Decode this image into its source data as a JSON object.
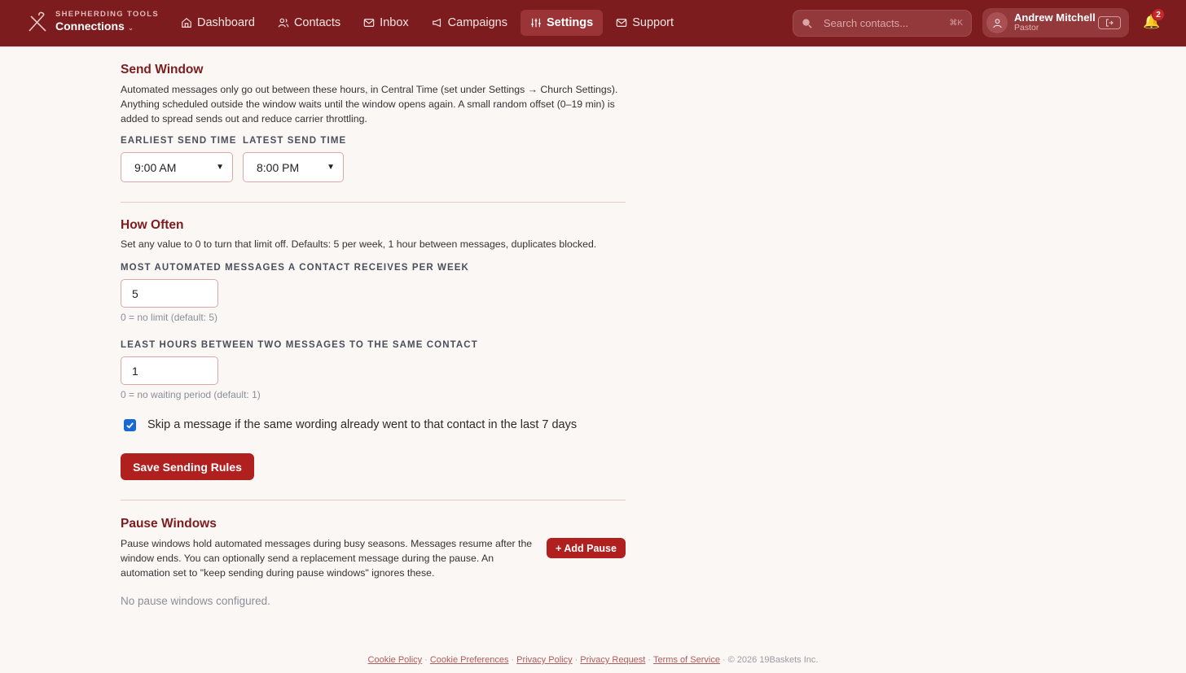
{
  "brand": {
    "small": "SHEPHERDING TOOLS",
    "main": "Connections",
    "caret": "⌄"
  },
  "nav": {
    "items": [
      {
        "label": "Dashboard",
        "icon": "home-icon"
      },
      {
        "label": "Contacts",
        "icon": "contacts-icon"
      },
      {
        "label": "Inbox",
        "icon": "mail-icon"
      },
      {
        "label": "Campaigns",
        "icon": "megaphone-icon"
      },
      {
        "label": "Settings",
        "icon": "sliders-icon",
        "active": true
      },
      {
        "label": "Support",
        "icon": "mail-icon"
      }
    ]
  },
  "search": {
    "placeholder": "Search contacts...",
    "shortcut": "⌘K"
  },
  "user": {
    "name": "Andrew Mitchell",
    "role": "Pastor"
  },
  "notifications": {
    "count": "2"
  },
  "send_window": {
    "title": "Send Window",
    "description": "Automated messages only go out between these hours, in Central Time (set under Settings → Church Settings). Anything scheduled outside the window waits until the window opens again. A small random offset (0–19 min) is added to spread sends out and reduce carrier throttling.",
    "earliest_label": "EARLIEST SEND TIME",
    "earliest_value": "9:00 AM",
    "latest_label": "LATEST SEND TIME",
    "latest_value": "8:00 PM"
  },
  "how_often": {
    "title": "How Often",
    "description": "Set any value to 0 to turn that limit off. Defaults: 5 per week, 1 hour between messages, duplicates blocked.",
    "per_week_label": "MOST AUTOMATED MESSAGES A CONTACT RECEIVES PER WEEK",
    "per_week_value": "5",
    "per_week_hint": "0 = no limit (default: 5)",
    "hours_label": "LEAST HOURS BETWEEN TWO MESSAGES TO THE SAME CONTACT",
    "hours_value": "1",
    "hours_hint": "0 = no waiting period (default: 1)",
    "skip_duplicate_label": "Skip a message if the same wording already went to that contact in the last 7 days",
    "skip_duplicate_checked": true,
    "save_label": "Save Sending Rules"
  },
  "pause_windows": {
    "title": "Pause Windows",
    "description": "Pause windows hold automated messages during busy seasons. Messages resume after the window ends. You can optionally send a replacement message during the pause. An automation set to \"keep sending during pause windows\" ignores these.",
    "add_label": "+ Add Pause",
    "empty_text": "No pause windows configured."
  },
  "footer": {
    "links": [
      "Cookie Policy",
      "Cookie Preferences",
      "Privacy Policy",
      "Privacy Request",
      "Terms of Service"
    ],
    "separator": "·",
    "copyright": "© 2026 19Baskets Inc."
  },
  "colors": {
    "topbar": "#7c1c1e",
    "accent": "#b0201f",
    "heading": "#7c1c1e",
    "checkbox": "#1769d6"
  }
}
